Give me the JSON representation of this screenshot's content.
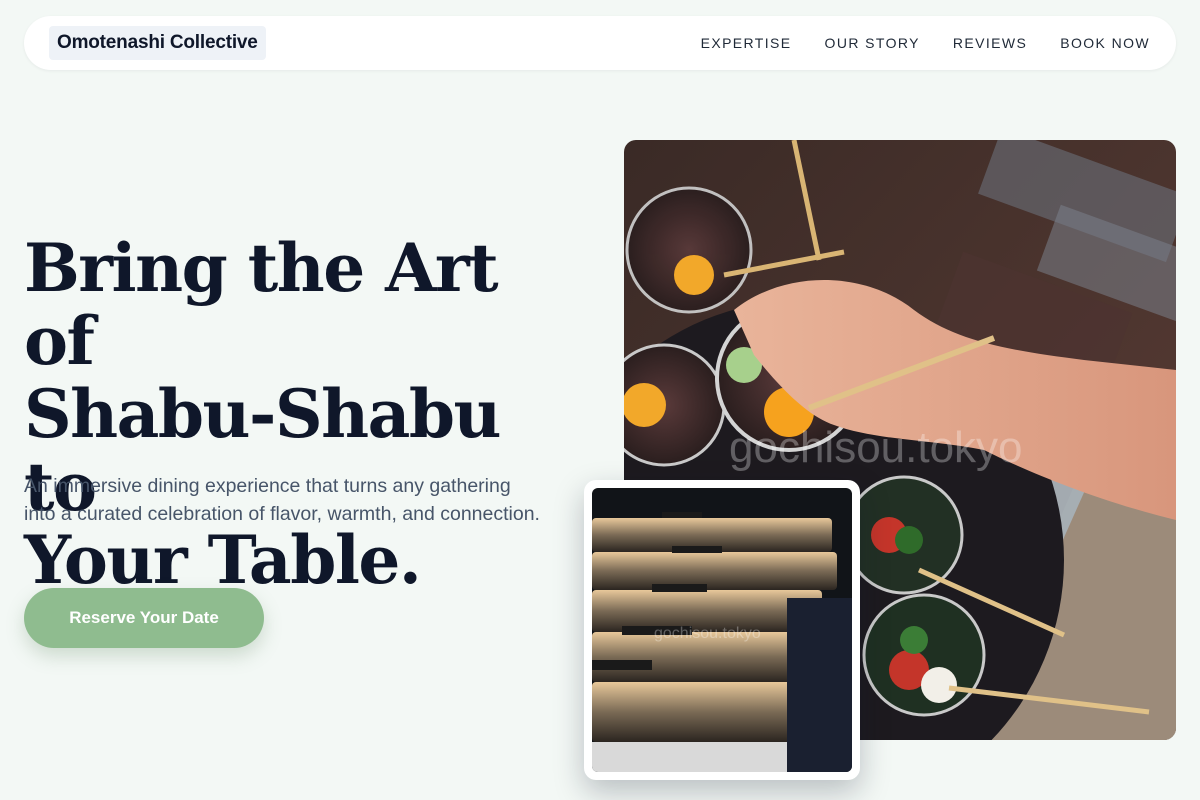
{
  "nav": {
    "brand": "Omotenashi Collective",
    "links": [
      "EXPERTISE",
      "OUR STORY",
      "REVIEWS",
      "BOOK NOW"
    ]
  },
  "hero": {
    "headline_lines": [
      "Bring the Art of",
      "Shabu-Shabu to",
      "Your Table."
    ],
    "subtext": "An immersive dining experience that turns any gathering into a curated celebration of flavor, warmth, and connection.",
    "cta_label": "Reserve Your Date"
  },
  "images": {
    "main_watermark": "gochisou.tokyo",
    "inset_watermark": "gochisou.tokyo"
  },
  "colors": {
    "background": "#f3f8f5",
    "accent": "#8fbc8f",
    "text": "#0f172a",
    "muted": "#475569"
  }
}
